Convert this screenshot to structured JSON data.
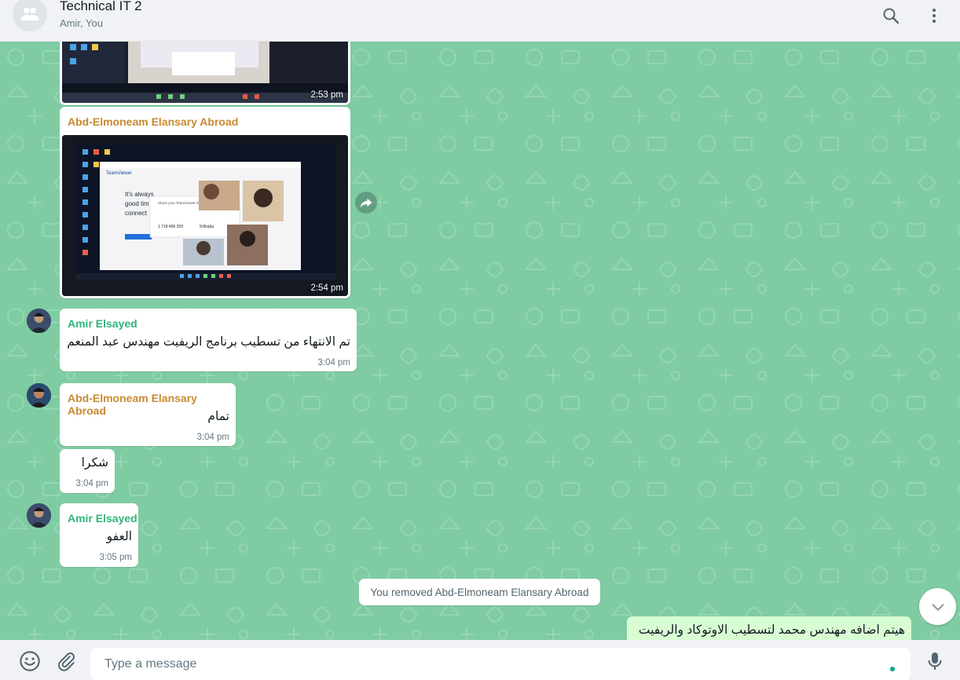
{
  "header": {
    "title": "Technical IT 2",
    "subtitle": "Amir, You"
  },
  "messages": {
    "photo1_time": "2:53 pm",
    "photo2_sender": "Abd-Elmoneam Elansary Abroad",
    "photo2_time": "2:54 pm",
    "photo2_screen": {
      "app": "TeamViewer",
      "headline_1": "It's always",
      "headline_2": "good tim",
      "headline_3": "connect",
      "dialog_title": "Share your TeamViewer ID",
      "id_value": "1 718 496 259",
      "password": "5r5kq9a"
    },
    "m1_sender": "Amir Elsayed",
    "m1_text": "تم الانتهاء من تسطيب برنامج الريفيت مهندس عبد المنعم",
    "m1_time": "3:04 pm",
    "m2_sender": "Abd-Elmoneam Elansary Abroad",
    "m2_text": "تمام",
    "m2_time": "3:04 pm",
    "m3_text": "شكرا",
    "m3_time": "3:04 pm",
    "m4_sender": "Amir Elsayed",
    "m4_text": "العفو",
    "m4_time": "3:05 pm",
    "system": "You removed Abd-Elmoneam Elansary Abroad",
    "out_text": "هيتم اضافه مهندس محمد لتسطيب الاوتوكاد والريفيت"
  },
  "composer": {
    "placeholder": "Type a message"
  },
  "colors": {
    "wallpaper": "#7fcca3",
    "sender_orange": "#c88a32",
    "sender_teal": "#2fb57a",
    "outgoing_bubble": "#d9fdd3"
  },
  "icons": [
    "group-avatar-icon",
    "search-icon",
    "menu-dots-icon",
    "forward-icon",
    "chevron-down-icon",
    "emoji-icon",
    "attach-icon",
    "mic-icon"
  ]
}
